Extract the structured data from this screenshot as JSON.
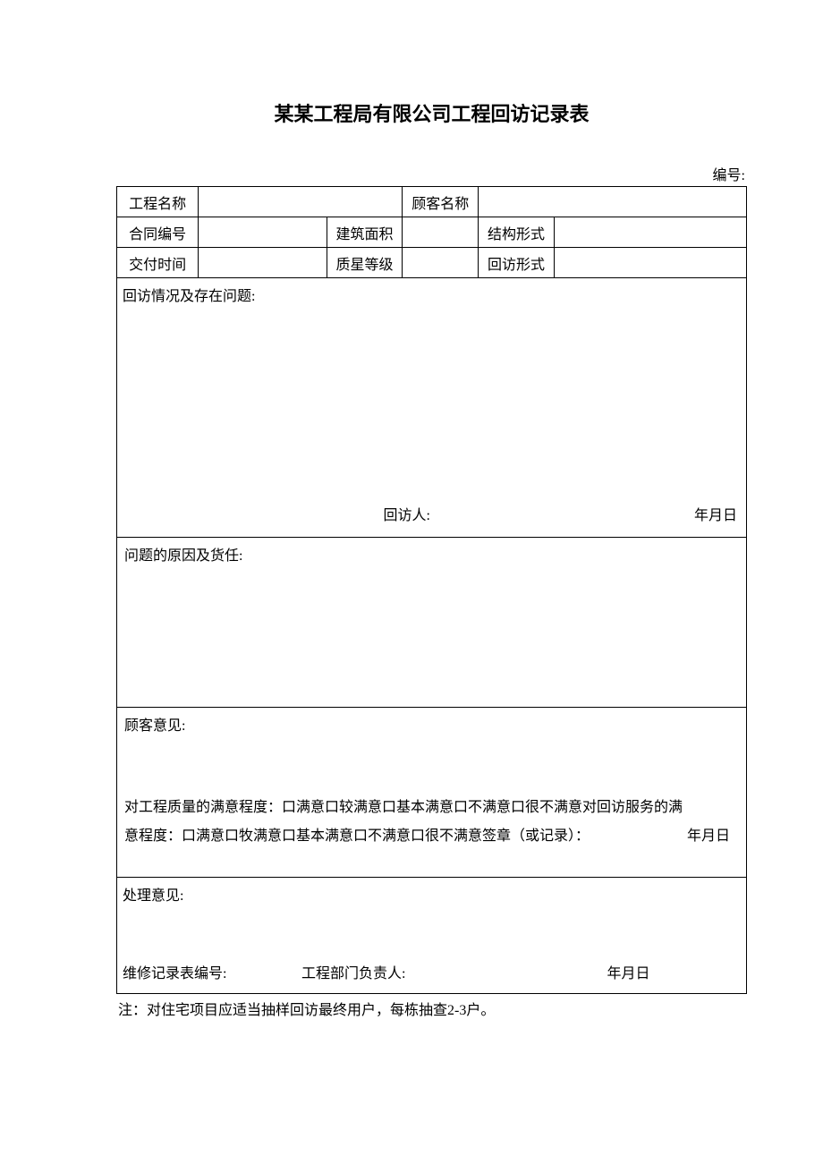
{
  "title": "某某工程局有限公司工程回访记录表",
  "serial_label": "编号:",
  "headers": {
    "project_name": "工程名称",
    "customer_name": "顾客名称",
    "contract_no": "合同编号",
    "building_area": "建筑面积",
    "structure_form": "结构形式",
    "delivery_time": "交付时间",
    "quality_grade": "质星等级",
    "visit_form": "回访形式"
  },
  "values": {
    "project_name": "",
    "customer_name": "",
    "contract_no": "",
    "building_area": "",
    "structure_form": "",
    "delivery_time": "",
    "quality_grade": "",
    "visit_form": ""
  },
  "visit_situation": {
    "label": "回访情况及存在问题:",
    "visitor_label": "回访人:",
    "date_label": "年月日"
  },
  "reason": {
    "label": "问题的原因及货任:"
  },
  "customer_opinion": {
    "label": "顾客意见:",
    "body_line1": "对工程质量的满意程度：口满意口较满意口基本满意口不满意口很不满意对回访服务的满",
    "body_line2_prefix": "意程度：口满意口牧满意口基本满意口不满意口很不满意签章（或记录）：",
    "date_label": "年月日"
  },
  "handle": {
    "label": "处理意见:",
    "record_no_label": "维修记录表编号:",
    "manager_label": "工程部门负责人:",
    "date_label": "年月日"
  },
  "note": "注：对住宅项目应适当抽样回访最终用户，每栋抽查2-3户。"
}
